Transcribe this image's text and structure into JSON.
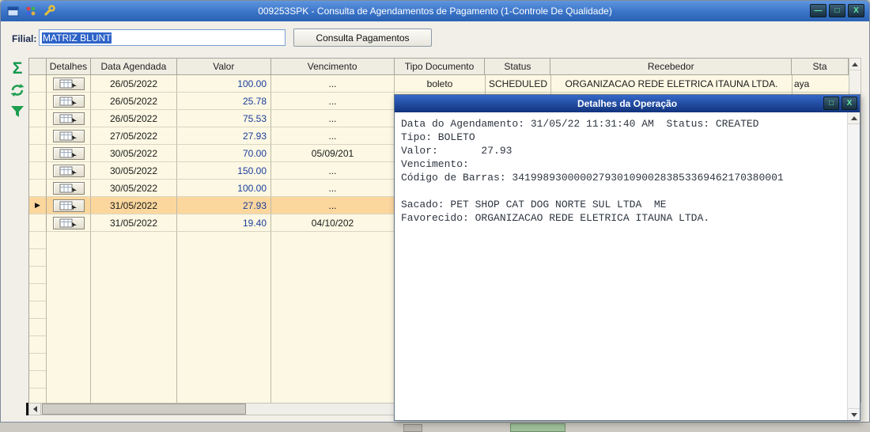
{
  "window": {
    "title": "009253SPK - Consulta de Agendamentos de Pagamento (1-Controle De Qualidade)",
    "titlebar_icons": [
      "window-icon",
      "beads-icon",
      "wrench-icon"
    ],
    "controls": {
      "minimize": "—",
      "maximize": "□",
      "close": "X"
    }
  },
  "toolbar": {
    "filial_label": "Filial:",
    "filial_value": "MATRIZ BLUNT",
    "consulta_button_label": "Consulta Pagamentos"
  },
  "side_rail": {
    "icons": [
      "sum-icon",
      "export-icon",
      "filter-icon"
    ]
  },
  "grid": {
    "columns": [
      "",
      "Detalhes",
      "Data Agendada",
      "Valor",
      "Vencimento",
      "Tipo Documento",
      "Status",
      "Recebedor",
      "Sta"
    ],
    "current_row_marker": "▶",
    "rows": [
      {
        "data_agendada": "26/05/2022",
        "valor": "100.00",
        "vencimento": "...",
        "tipo_documento": "boleto",
        "status": "SCHEDULED",
        "recebedor": "ORGANIZACAO REDE ELETRICA ITAUNA LTDA.",
        "sta": "aya"
      },
      {
        "data_agendada": "26/05/2022",
        "valor": "25.78",
        "vencimento": "..."
      },
      {
        "data_agendada": "26/05/2022",
        "valor": "75.53",
        "vencimento": "..."
      },
      {
        "data_agendada": "27/05/2022",
        "valor": "27.93",
        "vencimento": "..."
      },
      {
        "data_agendada": "30/05/2022",
        "valor": "70.00",
        "vencimento": "05/09/201"
      },
      {
        "data_agendada": "30/05/2022",
        "valor": "150.00",
        "vencimento": "..."
      },
      {
        "data_agendada": "30/05/2022",
        "valor": "100.00",
        "vencimento": "..."
      },
      {
        "data_agendada": "31/05/2022",
        "valor": "27.93",
        "vencimento": "...",
        "selected": true
      },
      {
        "data_agendada": "31/05/2022",
        "valor": "19.40",
        "vencimento": "04/10/202"
      }
    ]
  },
  "popup": {
    "title": "Detalhes da Operação",
    "controls": {
      "maximize": "□",
      "close": "X"
    },
    "lines": [
      "Data do Agendamento: 31/05/22 11:31:40 AM  Status: CREATED",
      "Tipo: BOLETO",
      "Valor:       27.93",
      "Vencimento:",
      "Código de Barras: 34199893000002793010900283853369462170380001",
      "",
      "Sacado: PET SHOP CAT DOG NORTE SUL LTDA  ME",
      "Favorecido: ORGANIZACAO REDE ELETRICA ITAUNA LTDA."
    ]
  },
  "colors": {
    "titlebar_blue": "#3A74C8",
    "popup_titlebar_blue": "#12337E",
    "grid_row_cream": "#FCF8E3",
    "selected_row_orange": "#FBD79E",
    "valor_text_blue": "#1B3C9C",
    "control_glyph_green": "#5FE9A0"
  }
}
